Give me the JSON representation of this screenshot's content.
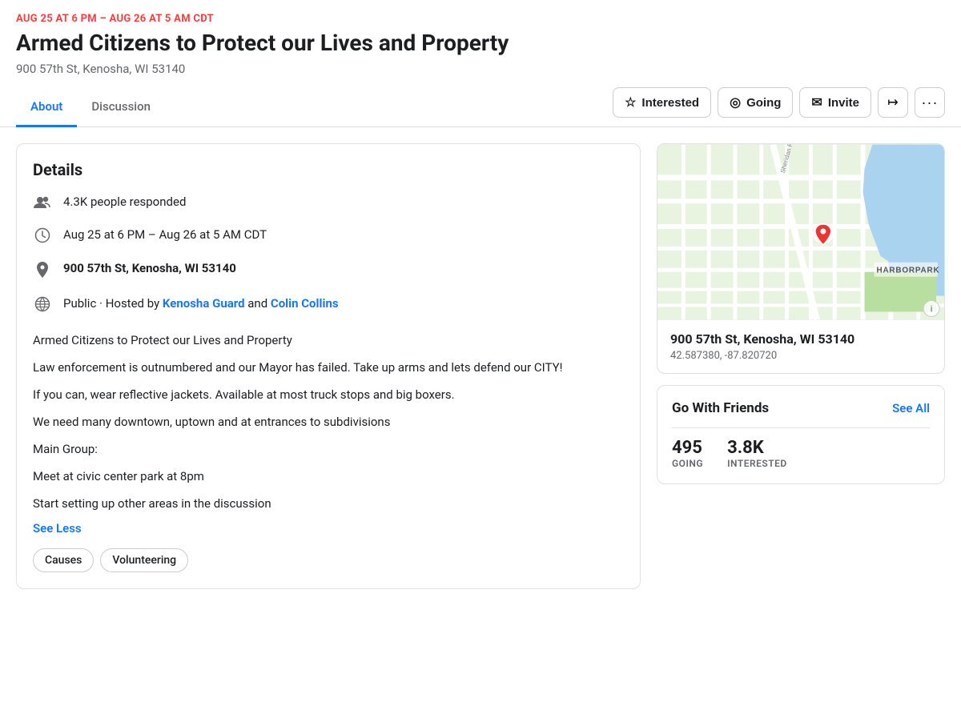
{
  "event": {
    "date_range": "AUG 25 AT 6 PM – AUG 26 AT 5 AM CDT",
    "title": "Armed Citizens to Protect our Lives and Property",
    "location_header": "900 57th St, Kenosha, WI 53140"
  },
  "nav": {
    "tabs": [
      {
        "id": "about",
        "label": "About",
        "active": true
      },
      {
        "id": "discussion",
        "label": "Discussion",
        "active": false
      }
    ]
  },
  "actions": {
    "interested_label": "Interested",
    "going_label": "Going",
    "invite_label": "Invite"
  },
  "details": {
    "title": "Details",
    "people_responded": "4.3K people responded",
    "event_time": "Aug 25 at 6 PM – Aug 26 at 5 AM CDT",
    "address": "900 57th St, Kenosha, WI 53140",
    "visibility": "Public",
    "hosted_by_prefix": "Hosted by",
    "host1": "Kenosha Guard",
    "host2": "Colin Collins"
  },
  "description": {
    "line1": "Armed Citizens to Protect our Lives and Property",
    "line2": "Law enforcement is outnumbered and our Mayor has failed. Take up arms and lets defend our CITY!",
    "line3": "If you can, wear reflective jackets. Available at most truck stops and big boxers.",
    "line4": "We need many downtown, uptown and at entrances to subdivisions",
    "line5": "Main Group:",
    "line6": "Meet at civic center park at 8pm",
    "line7": "Start setting up other areas in the discussion",
    "see_less": "See Less"
  },
  "tags": [
    {
      "label": "Causes"
    },
    {
      "label": "Volunteering"
    }
  ],
  "map": {
    "address": "900 57th St, Kenosha, WI 53140",
    "coords": "42.587380, -87.820720",
    "label_harborpark": "HARBORPARK"
  },
  "friends": {
    "title": "Go With Friends",
    "see_all": "See All",
    "going_count": "495",
    "going_label": "GOING",
    "interested_count": "3.8K",
    "interested_label": "INTERESTED"
  }
}
